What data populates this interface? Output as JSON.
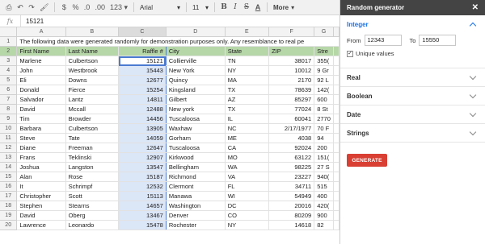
{
  "toolbar": {
    "print_icon": "⎙",
    "undo_icon": "↶",
    "redo_icon": "↷",
    "paint_icon": "🖌",
    "currency": "$",
    "percent": "%",
    "dec_less": ".0",
    "dec_more": ".00",
    "format_123": "123 ▾",
    "font": "Arial",
    "font_caret": "▾",
    "size": "11",
    "size_caret": "▾",
    "bold": "B",
    "italic": "I",
    "strike": "S",
    "text_color": "A",
    "more": "More",
    "more_caret": "▾"
  },
  "formula_bar": {
    "fx": "fx",
    "value": "15121"
  },
  "grid": {
    "columns": [
      "A",
      "B",
      "C",
      "D",
      "E",
      "F",
      "G"
    ],
    "selected_column": "C",
    "rows": [
      {
        "n": "1",
        "note": "The following data were generated randomly for demonstration purposes only. Any resemblance to real pe"
      },
      {
        "n": "2",
        "hdr": true,
        "cells": [
          "First Name",
          "Last Name",
          "Raffle #",
          "City",
          "State",
          "ZIP",
          "Stre"
        ]
      },
      {
        "n": "3",
        "cells": [
          "Marlene",
          "Culbertson",
          "15121",
          "Collierville",
          "TN",
          "38017",
          "355("
        ]
      },
      {
        "n": "4",
        "cells": [
          "John",
          "Westbrook",
          "15443",
          "New York",
          "NY",
          "10012",
          "9 Gr"
        ]
      },
      {
        "n": "5",
        "cells": [
          "Eli",
          "Downs",
          "12677",
          "Quincy",
          "MA",
          "2170",
          "92 L"
        ]
      },
      {
        "n": "6",
        "cells": [
          "Donald",
          "Fierce",
          "15254",
          "Kingsland",
          "TX",
          "78639",
          "142("
        ]
      },
      {
        "n": "7",
        "cells": [
          "Salvador",
          "Lantz",
          "14811",
          "Gilbert",
          "AZ",
          "85297",
          "600"
        ]
      },
      {
        "n": "8",
        "cells": [
          "David",
          "Mccall",
          "12488",
          "New york",
          "TX",
          "77024",
          "8 St"
        ]
      },
      {
        "n": "9",
        "cells": [
          "Tim",
          "Browder",
          "14456",
          "Tuscaloosa",
          "IL",
          "60041",
          "2770"
        ]
      },
      {
        "n": "10",
        "cells": [
          "Barbara",
          "Culbertson",
          "13905",
          "Waxhaw",
          "NC",
          "2/17/1977",
          "70 F"
        ]
      },
      {
        "n": "11",
        "cells": [
          "Steve",
          "Tate",
          "14059",
          "Gorham",
          "ME",
          "4038",
          "94"
        ]
      },
      {
        "n": "12",
        "cells": [
          "Diane",
          "Freeman",
          "12647",
          "Tuscaloosa",
          "CA",
          "92024",
          "200"
        ]
      },
      {
        "n": "13",
        "cells": [
          "Frans",
          "Teklinski",
          "12907",
          "Kirkwood",
          "MO",
          "63122",
          "151("
        ]
      },
      {
        "n": "14",
        "cells": [
          "Joshua",
          "Langston",
          "13547",
          "Bellingham",
          "WA",
          "98225",
          "27 S"
        ]
      },
      {
        "n": "15",
        "cells": [
          "Alan",
          "Rose",
          "15187",
          "Richmond",
          "VA",
          "23227",
          "940("
        ]
      },
      {
        "n": "16",
        "cells": [
          "It",
          "Schrimpf",
          "12532",
          "Clermont",
          "FL",
          "34711",
          "515"
        ]
      },
      {
        "n": "17",
        "cells": [
          "Christopher",
          "Scott",
          "15113",
          "Manawa",
          "WI",
          "54949",
          "400"
        ]
      },
      {
        "n": "18",
        "cells": [
          "Stephen",
          "Stearns",
          "14657",
          "Washington",
          "DC",
          "20016",
          "420("
        ]
      },
      {
        "n": "19",
        "cells": [
          "David",
          "Oberg",
          "13467",
          "Denver",
          "CO",
          "80209",
          "900"
        ]
      },
      {
        "n": "20",
        "cells": [
          "Lawrence",
          "Leonardo",
          "15478",
          "Rochester",
          "NY",
          "14618",
          "82"
        ]
      }
    ]
  },
  "sidebar": {
    "title": "Random generator",
    "close_icon": "✕",
    "integer": {
      "title": "Integer",
      "from_label": "From",
      "from_value": "12343",
      "to_label": "To",
      "to_value": "15550",
      "unique_label": "Unique values",
      "unique_checked": "✓"
    },
    "sections": [
      "Real",
      "Boolean",
      "Date",
      "Strings"
    ],
    "generate": "GENERATE"
  }
}
